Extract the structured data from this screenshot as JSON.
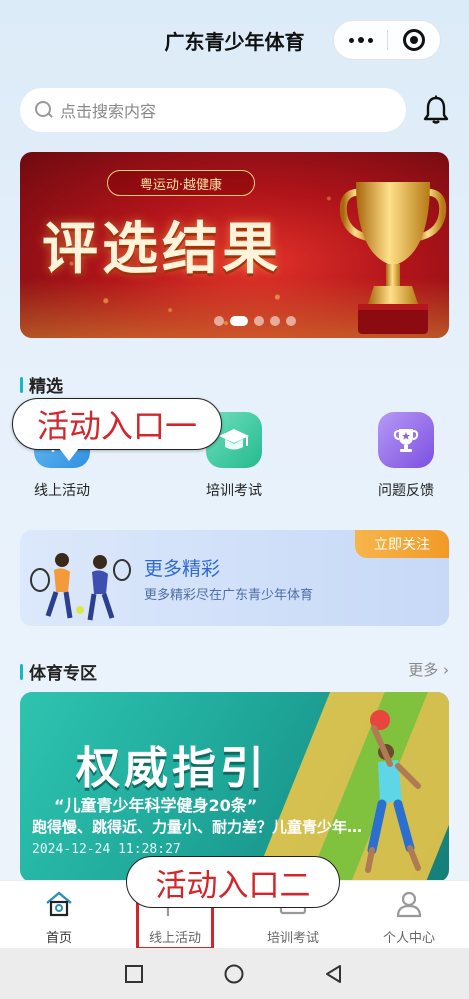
{
  "header": {
    "title": "广东青少年体育"
  },
  "search": {
    "placeholder": "点击搜索内容"
  },
  "banner": {
    "pill": "粤运动·越健康",
    "headline": "评选结果"
  },
  "featured": {
    "title": "精选",
    "items": [
      {
        "label": "线上活动",
        "icon": "activity-icon",
        "color": "#3fa7e8"
      },
      {
        "label": "培训考试",
        "icon": "graduation-cap-icon",
        "color": "#35c79d"
      },
      {
        "label": "问题反馈",
        "icon": "trophy-feedback-icon",
        "color": "#8a63e6"
      }
    ]
  },
  "annotations": {
    "entry1": "活动入口一",
    "entry2": "活动入口二"
  },
  "promo": {
    "title": "更多精彩",
    "subtitle": "更多精彩尽在广东青少年体育",
    "follow": "立即关注"
  },
  "sports": {
    "title": "体育专区",
    "more": "更多",
    "card": {
      "headline": "权威指引",
      "quote": "“儿童青少年科学健身20条”",
      "desc": "跑得慢、跳得近、力量小、耐力差？儿童青少年…",
      "date": "2024-12-24 11:28:27"
    }
  },
  "tabbar": {
    "items": [
      {
        "label": "首页",
        "icon": "home-icon"
      },
      {
        "label": "线上活动",
        "icon": "flag-icon"
      },
      {
        "label": "培训考试",
        "icon": "exam-icon"
      },
      {
        "label": "个人中心",
        "icon": "user-icon"
      }
    ]
  },
  "colors": {
    "accent": "#16b8c8",
    "annotation": "#d3262a",
    "banner": "#b0141a"
  }
}
